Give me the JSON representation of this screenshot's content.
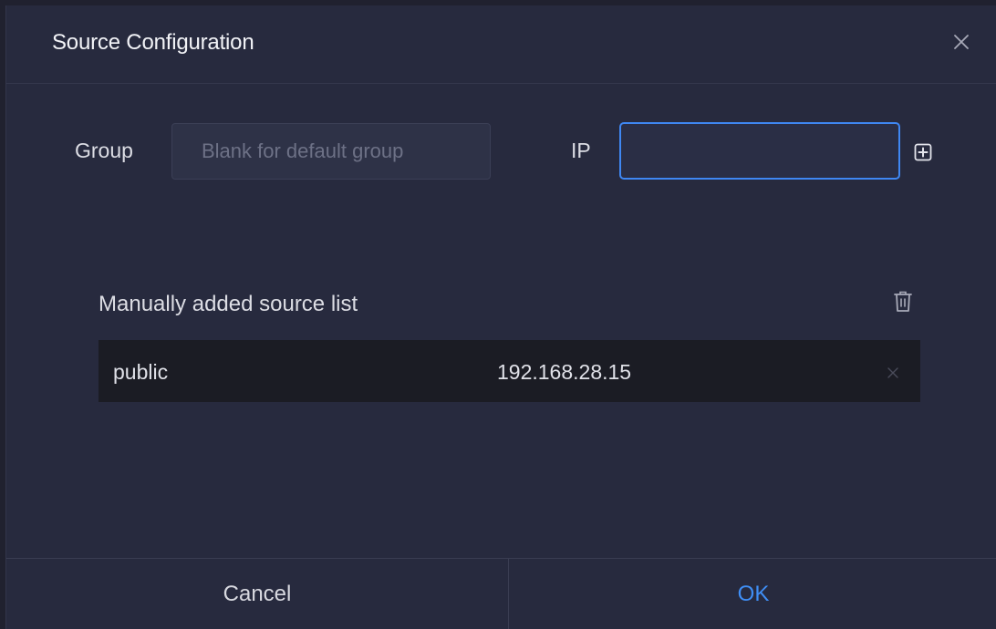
{
  "dialog": {
    "title": "Source Configuration",
    "close_icon": "close-icon"
  },
  "form": {
    "group_label": "Group",
    "group_placeholder": "Blank for default group",
    "group_value": "",
    "ip_label": "IP",
    "ip_placeholder": "",
    "ip_value": "",
    "add_icon": "plus-square-icon"
  },
  "source_list": {
    "title": "Manually added source list",
    "delete_all_icon": "trash-icon",
    "rows": [
      {
        "group": "public",
        "ip": "192.168.28.15",
        "remove_icon": "close-icon"
      }
    ]
  },
  "footer": {
    "cancel_label": "Cancel",
    "ok_label": "OK"
  },
  "colors": {
    "background": "#272a3e",
    "accent": "#3f8ef5",
    "row_background": "#1b1c24"
  }
}
